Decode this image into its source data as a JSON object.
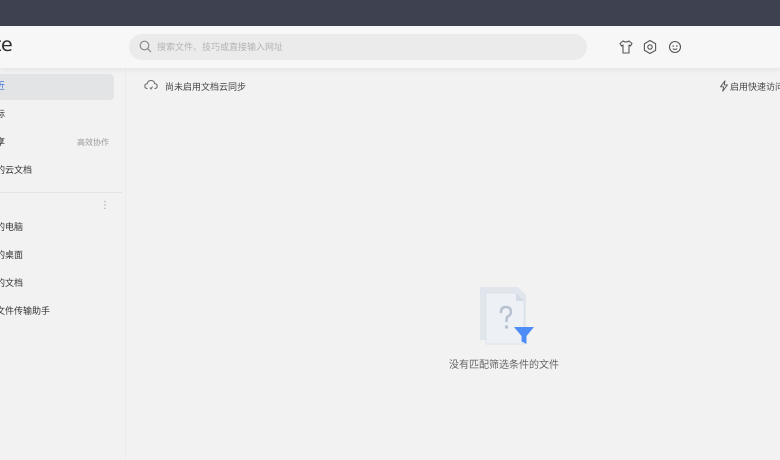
{
  "app": {
    "logo_text": "te"
  },
  "search": {
    "placeholder": "搜索文件、技巧或直接输入网址"
  },
  "header_icons": [
    "skin-icon",
    "settings-icon",
    "feedback-icon"
  ],
  "sidebar": {
    "items": [
      {
        "label": "近",
        "active": true
      },
      {
        "label": "标"
      },
      {
        "label": "享",
        "badge": "高效协作"
      },
      {
        "label": "的云文档"
      }
    ],
    "local_items": [
      {
        "label": "的电脑"
      },
      {
        "label": "的桌面"
      },
      {
        "label": "的文档"
      },
      {
        "label": "文件传输助手"
      }
    ]
  },
  "main": {
    "sync_text": "尚未启用文档云同步",
    "quick_access": "启用快速访问",
    "empty_text": "没有匹配筛选条件的文件"
  },
  "colors": {
    "accent": "#3b6fd6",
    "titlebar": "#3d4150",
    "funnel": "#4e8df5"
  }
}
